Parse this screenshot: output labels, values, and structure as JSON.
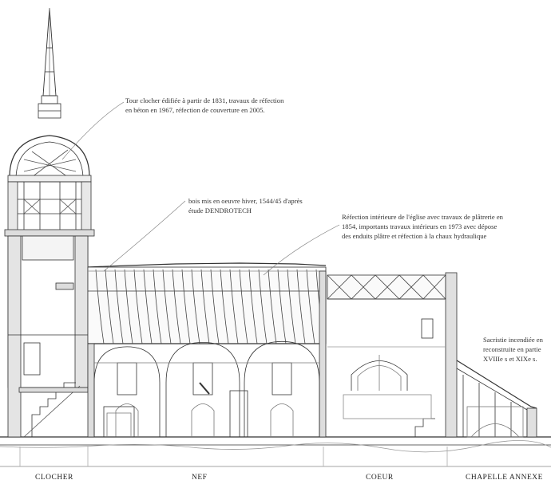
{
  "annotations": {
    "clocher_note": {
      "line1": "Tour clocher édifiée à partir de 1831, travaux de réfection",
      "line2": "en béton en 1967, réfection de couverture en 2005."
    },
    "bois_note": {
      "line1": "bois mis en oeuvre hiver, 1544/45 d'après",
      "line2": "étude DENDROTECH"
    },
    "refection_note": {
      "line1": "Réfection intérieure de l'église avec travaux de plâtrerie en",
      "line2": "1854, importants travaux intérieurs en 1973 avec dépose",
      "line3": "des enduits plâtre et réfection à la chaux hydraulique"
    },
    "sacristie_note": {
      "line1": "Sacristie incendiée en",
      "line2": "reconstruite en partie",
      "line3": "XVIIIe s et XIXe s."
    }
  },
  "sections": {
    "clocher": "CLOCHER",
    "nef": "NEF",
    "coeur": "COEUR",
    "chapelle": "CHAPELLE ANNEXE"
  }
}
